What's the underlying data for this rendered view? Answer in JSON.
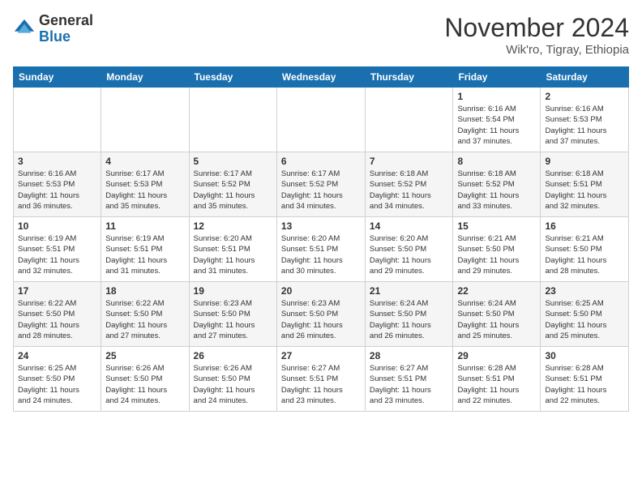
{
  "header": {
    "logo_general": "General",
    "logo_blue": "Blue",
    "month_title": "November 2024",
    "location": "Wik'ro, Tigray, Ethiopia"
  },
  "weekdays": [
    "Sunday",
    "Monday",
    "Tuesday",
    "Wednesday",
    "Thursday",
    "Friday",
    "Saturday"
  ],
  "weeks": [
    [
      {
        "day": "",
        "info": ""
      },
      {
        "day": "",
        "info": ""
      },
      {
        "day": "",
        "info": ""
      },
      {
        "day": "",
        "info": ""
      },
      {
        "day": "",
        "info": ""
      },
      {
        "day": "1",
        "info": "Sunrise: 6:16 AM\nSunset: 5:54 PM\nDaylight: 11 hours\nand 37 minutes."
      },
      {
        "day": "2",
        "info": "Sunrise: 6:16 AM\nSunset: 5:53 PM\nDaylight: 11 hours\nand 37 minutes."
      }
    ],
    [
      {
        "day": "3",
        "info": "Sunrise: 6:16 AM\nSunset: 5:53 PM\nDaylight: 11 hours\nand 36 minutes."
      },
      {
        "day": "4",
        "info": "Sunrise: 6:17 AM\nSunset: 5:53 PM\nDaylight: 11 hours\nand 35 minutes."
      },
      {
        "day": "5",
        "info": "Sunrise: 6:17 AM\nSunset: 5:52 PM\nDaylight: 11 hours\nand 35 minutes."
      },
      {
        "day": "6",
        "info": "Sunrise: 6:17 AM\nSunset: 5:52 PM\nDaylight: 11 hours\nand 34 minutes."
      },
      {
        "day": "7",
        "info": "Sunrise: 6:18 AM\nSunset: 5:52 PM\nDaylight: 11 hours\nand 34 minutes."
      },
      {
        "day": "8",
        "info": "Sunrise: 6:18 AM\nSunset: 5:52 PM\nDaylight: 11 hours\nand 33 minutes."
      },
      {
        "day": "9",
        "info": "Sunrise: 6:18 AM\nSunset: 5:51 PM\nDaylight: 11 hours\nand 32 minutes."
      }
    ],
    [
      {
        "day": "10",
        "info": "Sunrise: 6:19 AM\nSunset: 5:51 PM\nDaylight: 11 hours\nand 32 minutes."
      },
      {
        "day": "11",
        "info": "Sunrise: 6:19 AM\nSunset: 5:51 PM\nDaylight: 11 hours\nand 31 minutes."
      },
      {
        "day": "12",
        "info": "Sunrise: 6:20 AM\nSunset: 5:51 PM\nDaylight: 11 hours\nand 31 minutes."
      },
      {
        "day": "13",
        "info": "Sunrise: 6:20 AM\nSunset: 5:51 PM\nDaylight: 11 hours\nand 30 minutes."
      },
      {
        "day": "14",
        "info": "Sunrise: 6:20 AM\nSunset: 5:50 PM\nDaylight: 11 hours\nand 29 minutes."
      },
      {
        "day": "15",
        "info": "Sunrise: 6:21 AM\nSunset: 5:50 PM\nDaylight: 11 hours\nand 29 minutes."
      },
      {
        "day": "16",
        "info": "Sunrise: 6:21 AM\nSunset: 5:50 PM\nDaylight: 11 hours\nand 28 minutes."
      }
    ],
    [
      {
        "day": "17",
        "info": "Sunrise: 6:22 AM\nSunset: 5:50 PM\nDaylight: 11 hours\nand 28 minutes."
      },
      {
        "day": "18",
        "info": "Sunrise: 6:22 AM\nSunset: 5:50 PM\nDaylight: 11 hours\nand 27 minutes."
      },
      {
        "day": "19",
        "info": "Sunrise: 6:23 AM\nSunset: 5:50 PM\nDaylight: 11 hours\nand 27 minutes."
      },
      {
        "day": "20",
        "info": "Sunrise: 6:23 AM\nSunset: 5:50 PM\nDaylight: 11 hours\nand 26 minutes."
      },
      {
        "day": "21",
        "info": "Sunrise: 6:24 AM\nSunset: 5:50 PM\nDaylight: 11 hours\nand 26 minutes."
      },
      {
        "day": "22",
        "info": "Sunrise: 6:24 AM\nSunset: 5:50 PM\nDaylight: 11 hours\nand 25 minutes."
      },
      {
        "day": "23",
        "info": "Sunrise: 6:25 AM\nSunset: 5:50 PM\nDaylight: 11 hours\nand 25 minutes."
      }
    ],
    [
      {
        "day": "24",
        "info": "Sunrise: 6:25 AM\nSunset: 5:50 PM\nDaylight: 11 hours\nand 24 minutes."
      },
      {
        "day": "25",
        "info": "Sunrise: 6:26 AM\nSunset: 5:50 PM\nDaylight: 11 hours\nand 24 minutes."
      },
      {
        "day": "26",
        "info": "Sunrise: 6:26 AM\nSunset: 5:50 PM\nDaylight: 11 hours\nand 24 minutes."
      },
      {
        "day": "27",
        "info": "Sunrise: 6:27 AM\nSunset: 5:51 PM\nDaylight: 11 hours\nand 23 minutes."
      },
      {
        "day": "28",
        "info": "Sunrise: 6:27 AM\nSunset: 5:51 PM\nDaylight: 11 hours\nand 23 minutes."
      },
      {
        "day": "29",
        "info": "Sunrise: 6:28 AM\nSunset: 5:51 PM\nDaylight: 11 hours\nand 22 minutes."
      },
      {
        "day": "30",
        "info": "Sunrise: 6:28 AM\nSunset: 5:51 PM\nDaylight: 11 hours\nand 22 minutes."
      }
    ]
  ]
}
